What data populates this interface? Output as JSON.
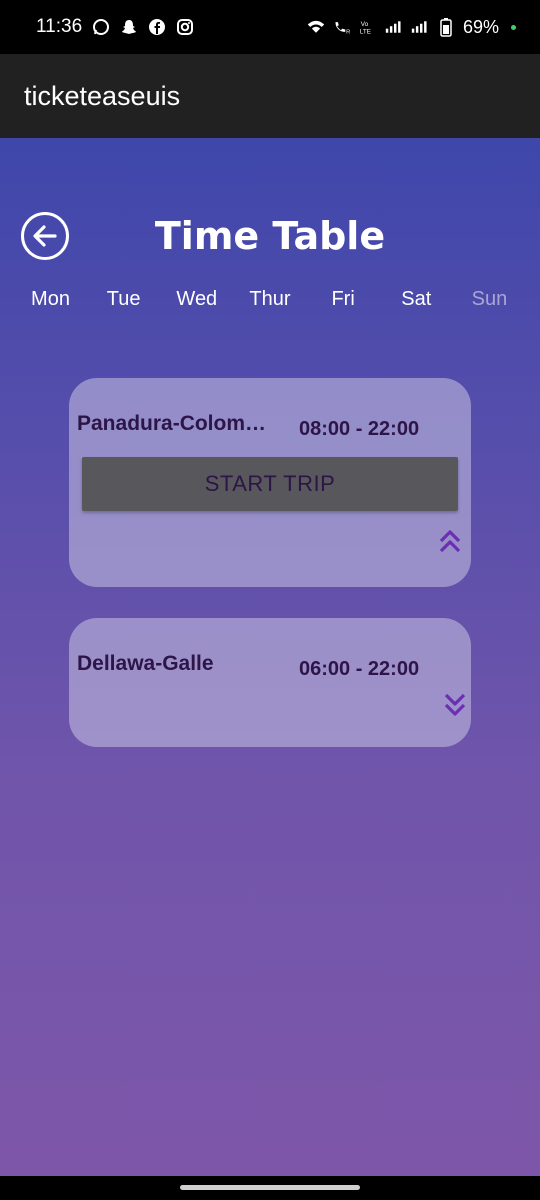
{
  "status_bar": {
    "time": "11:36",
    "battery": "69%",
    "left_icons": [
      "whatsapp-icon",
      "snapchat-icon",
      "facebook-icon",
      "instagram-icon"
    ],
    "right_icons": [
      "wifi-icon",
      "wifi-call-icon",
      "volte-icon",
      "signal-icon",
      "signal-icon",
      "battery-icon"
    ]
  },
  "app_bar": {
    "title": "ticketeaseuis"
  },
  "page": {
    "title": "Time Table"
  },
  "days": [
    {
      "label": "Mon",
      "active": true
    },
    {
      "label": "Tue",
      "active": true
    },
    {
      "label": "Wed",
      "active": true
    },
    {
      "label": "Thur",
      "active": true
    },
    {
      "label": "Fri",
      "active": true
    },
    {
      "label": "Sat",
      "active": true
    },
    {
      "label": "Sun",
      "active": false
    }
  ],
  "trips": [
    {
      "route": "Panadura-Colombo",
      "hours": "08:00 - 22:00",
      "expanded": true,
      "button_label": "START TRIP"
    },
    {
      "route": "Dellawa-Galle",
      "hours": "06:00 - 22:00",
      "expanded": false
    }
  ],
  "colors": {
    "gradient_top": "#3f47ab",
    "gradient_bottom": "#7e56a9",
    "card_text": "#2d1548",
    "chevron": "#6a2fb3"
  }
}
